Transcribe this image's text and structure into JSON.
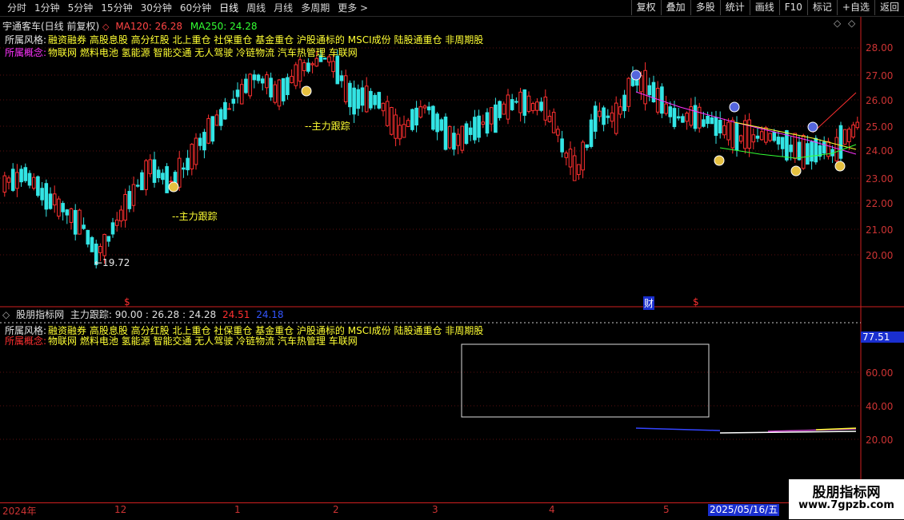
{
  "toolbar": {
    "tabs": [
      {
        "label": "分时"
      },
      {
        "label": "1分钟"
      },
      {
        "label": "5分钟"
      },
      {
        "label": "15分钟"
      },
      {
        "label": "30分钟"
      },
      {
        "label": "60分钟"
      },
      {
        "label": "日线"
      },
      {
        "label": "周线"
      },
      {
        "label": "月线"
      },
      {
        "label": "多周期"
      },
      {
        "label": "更多 >"
      }
    ],
    "active_tab": "日线",
    "buttons": [
      {
        "label": "复权"
      },
      {
        "label": "叠加"
      },
      {
        "label": "多股"
      },
      {
        "label": "统计"
      },
      {
        "label": "画线"
      },
      {
        "label": "F10"
      },
      {
        "label": "标记"
      },
      {
        "label": "+自选"
      },
      {
        "label": "返回"
      }
    ]
  },
  "header": {
    "stock_name": "宇通客车(日线 前复权)",
    "ma120": "MA120: 26.28",
    "ma250": "MA250: 24.28"
  },
  "info": {
    "style_label": "所属风格:",
    "style_value": "融资融券 高股息股 高分红股 北上重仓 社保重仓 基金重仓 沪股通标的 MSCI成份 陆股通重仓 非周期股",
    "concept_label": "所属概念:",
    "concept_value": "物联网 燃料电池 氢能源 智能交通 无人驾驶 冷链物流 汽车热管理 车联网"
  },
  "price_axis": {
    "ticks": [
      "28.00",
      "27.00",
      "26.00",
      "25.00",
      "24.00",
      "23.00",
      "22.00",
      "21.00",
      "20.00"
    ]
  },
  "annotations": {
    "low_price": "←19.72",
    "main_track": "--主力跟踪"
  },
  "markers": {
    "cai": "财",
    "dollar": "$"
  },
  "indicator": {
    "name": "股朋指标网",
    "title": "主力跟踪: 90.00 : 26.28 : 24.28",
    "v1": "24.51",
    "v2": "24.18",
    "current_value": "77.51",
    "ticks": [
      "60.00",
      "40.00",
      "20.00"
    ]
  },
  "bottom_axis": {
    "labels": [
      "2024年",
      "12",
      "1",
      "2",
      "3",
      "4",
      "5"
    ],
    "date": "2025/05/16/五"
  },
  "watermark": {
    "line1": "股朋指标网",
    "line2": "www.7gpzb.com"
  },
  "colors": {
    "up": "#ff3030",
    "down": "#33e5e5",
    "ma_up": "#ff33ff",
    "ma_yellow": "#ffff33",
    "ma_green": "#33ff33",
    "axis": "#cc3333"
  }
}
